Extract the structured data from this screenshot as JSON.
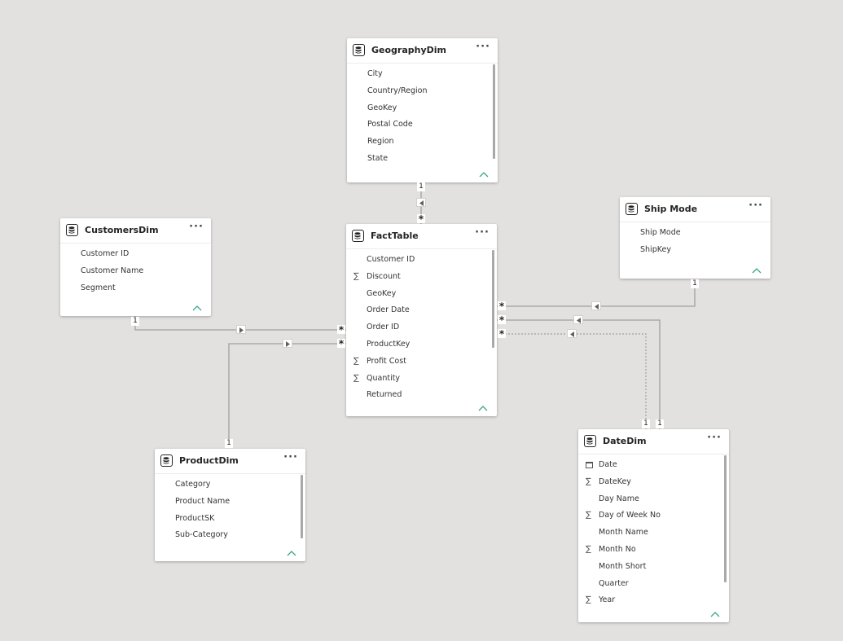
{
  "tables": {
    "geography": {
      "title": "GeographyDim",
      "fields": [
        "City",
        "Country/Region",
        "GeoKey",
        "Postal Code",
        "Region",
        "State"
      ]
    },
    "fact": {
      "title": "FactTable",
      "fields": [
        "Customer ID",
        "Discount",
        "GeoKey",
        "Order Date",
        "Order ID",
        "ProductKey",
        "Profit Cost",
        "Quantity",
        "Returned"
      ],
      "sum_fields": [
        "Discount",
        "Profit Cost",
        "Quantity"
      ]
    },
    "customers": {
      "title": "CustomersDim",
      "fields": [
        "Customer ID",
        "Customer Name",
        "Segment"
      ]
    },
    "shipmode": {
      "title": "Ship Mode",
      "fields": [
        "Ship Mode",
        "ShipKey"
      ]
    },
    "product": {
      "title": "ProductDim",
      "fields": [
        "Category",
        "Product Name",
        "ProductSK",
        "Sub-Category"
      ]
    },
    "date": {
      "title": "DateDim",
      "fields": [
        "Date",
        "DateKey",
        "Day Name",
        "Day of Week No",
        "Month Name",
        "Month No",
        "Month Short",
        "Quarter",
        "Year"
      ],
      "sum_fields": [
        "DateKey",
        "Day of Week No",
        "Month No",
        "Year"
      ],
      "calendar_fields": [
        "Date"
      ]
    }
  },
  "menu_label": "···",
  "sum_symbol": "∑",
  "cardinality": {
    "one": "1",
    "many": "*"
  },
  "colors": {
    "canvas": "#e2e1df",
    "card": "#ffffff",
    "line": "#a0a0a0",
    "caret": "#3aa58a",
    "text": "#252423"
  },
  "icons": {
    "table": "database-icon",
    "more": "ellipsis-icon",
    "collapse": "chevron-up-icon",
    "sum": "sigma-icon",
    "calendar": "calendar-icon",
    "direction": "triangle-arrow-icon"
  }
}
